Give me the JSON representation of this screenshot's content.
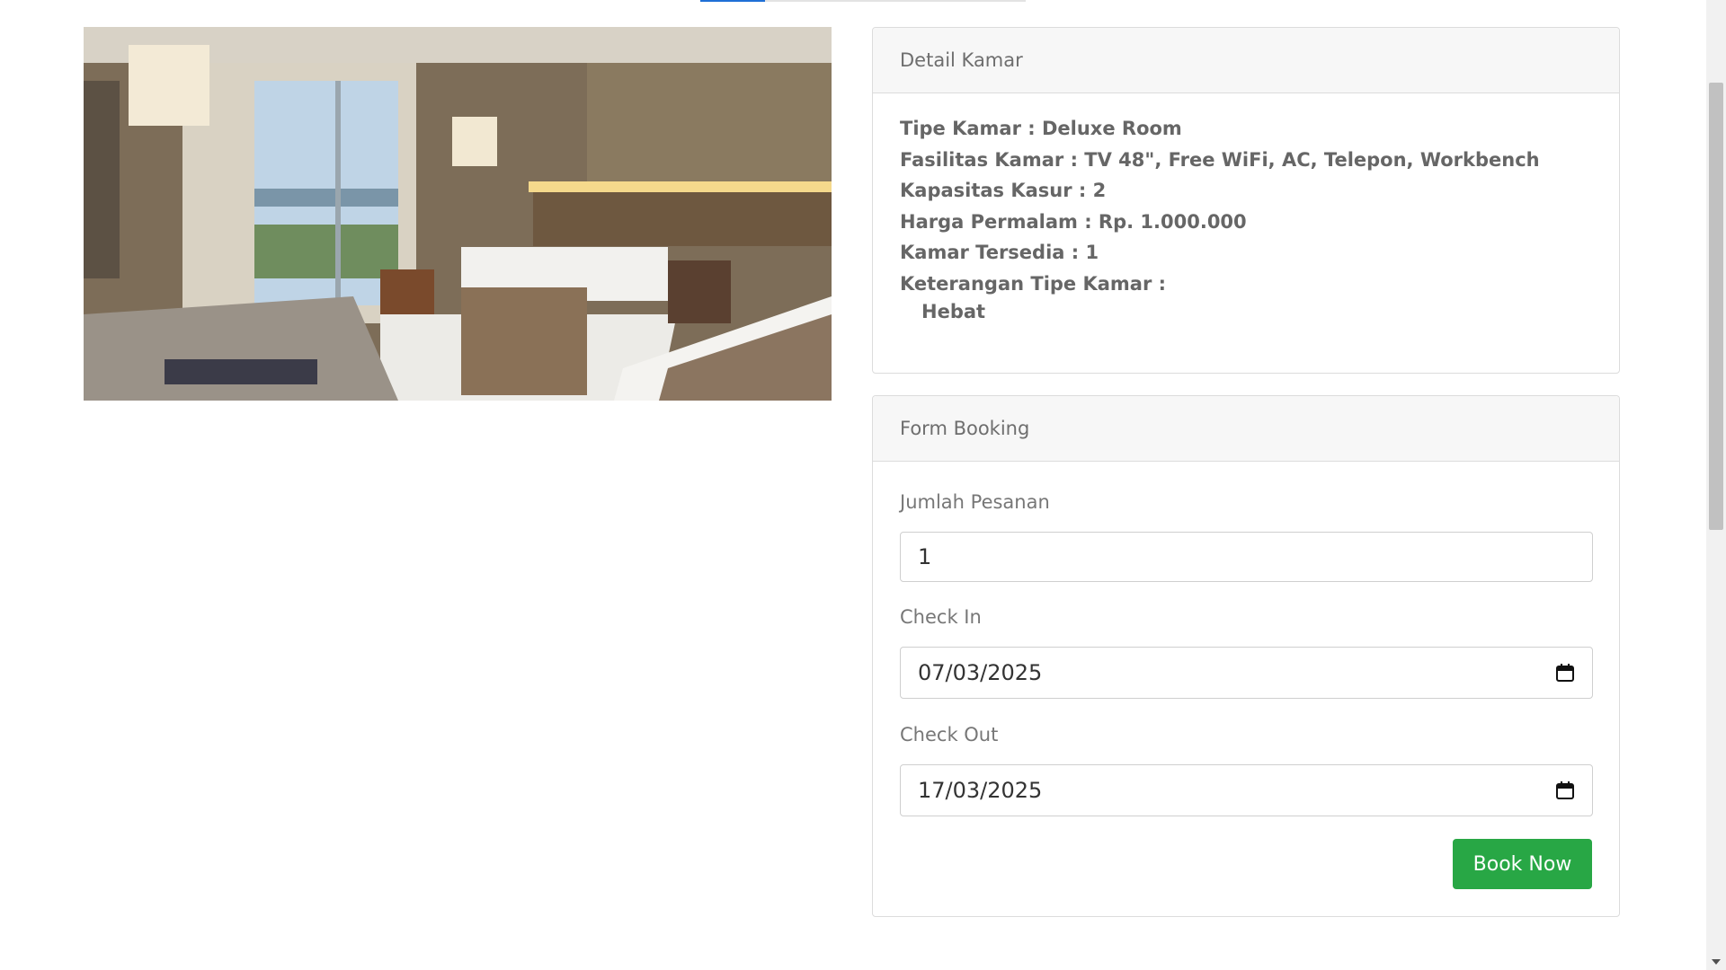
{
  "detail": {
    "header": "Detail Kamar",
    "tipe": "Tipe Kamar : Deluxe Room",
    "fasilitas": "Fasilitas Kamar : TV 48\", Free WiFi, AC, Telepon, Workbench",
    "kapasitas": "Kapasitas Kasur : 2",
    "harga": "Harga Permalam : Rp. 1.000.000",
    "tersedia": "Kamar Tersedia : 1",
    "keterangan_label": "Keterangan Tipe Kamar :",
    "keterangan_value": "Hebat"
  },
  "booking": {
    "header": "Form Booking",
    "jumlah_label": "Jumlah Pesanan",
    "jumlah_value": "1",
    "checkin_label": "Check In",
    "checkin_value": "07/03/2025",
    "checkout_label": "Check Out",
    "checkout_value": "17/03/2025",
    "book_button": "Book Now"
  },
  "colors": {
    "accent": "#28a745",
    "tab_active": "#1f6fd6"
  }
}
